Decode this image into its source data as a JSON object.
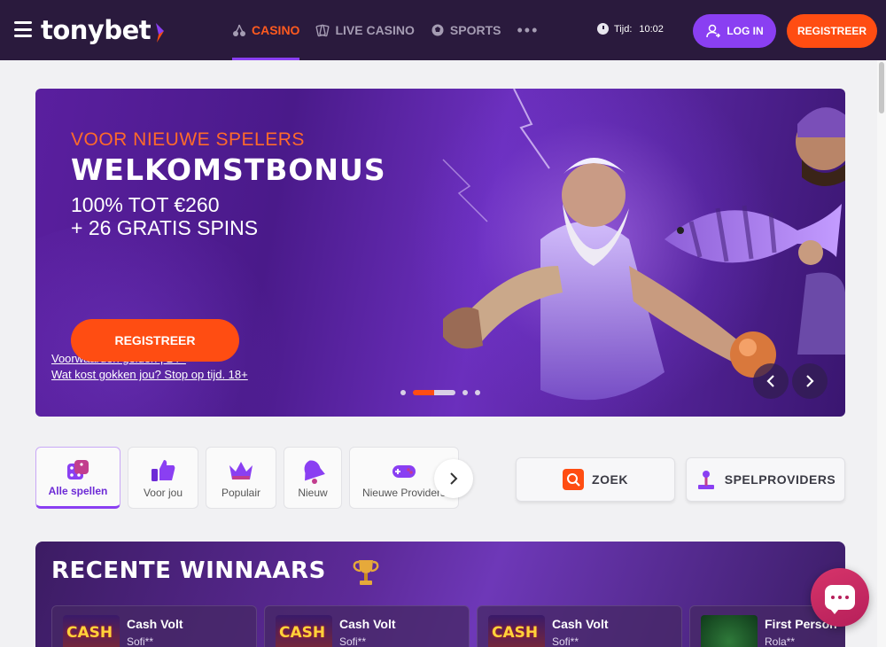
{
  "header": {
    "logo_text": "tonybet",
    "nav": [
      {
        "label": "CASINO",
        "icon": "cherries-icon",
        "active": true
      },
      {
        "label": "LIVE CASINO",
        "icon": "cards-icon",
        "active": false
      },
      {
        "label": "SPORTS",
        "icon": "ball-icon",
        "active": false
      }
    ],
    "more_label": "•••",
    "time_label": "Tijd:",
    "time_value": "10:02",
    "login_label": "LOG IN",
    "register_label": "REGISTREER"
  },
  "banner": {
    "subtitle": "VOOR NIEUWE SPELERS",
    "title": "WELKOMSTBONUS",
    "line1": "100% TOT €260",
    "line2": "+ 26 GRATIS SPINS",
    "button_label": "REGISTREER",
    "terms_link": "Voorwaarden gelden | 24+",
    "gambling_link": "Wat kost gokken jou? Stop op tijd. 18+",
    "slides_count": 5,
    "active_slide": 2
  },
  "categories": [
    {
      "label": "Alle spellen",
      "icon": "dice-icon",
      "active": true
    },
    {
      "label": "Voor jou",
      "icon": "thumbs-up-icon",
      "active": false
    },
    {
      "label": "Populair",
      "icon": "crown-icon",
      "active": false
    },
    {
      "label": "Nieuw",
      "icon": "bell-icon",
      "active": false
    },
    {
      "label": "Nieuwe Providers",
      "icon": "gamepad-icon",
      "active": false
    }
  ],
  "actions": {
    "search_label": "ZOEK",
    "providers_label": "SPELPROVIDERS"
  },
  "winners": {
    "title": "RECENTE WINNAARS",
    "items": [
      {
        "game": "Cash Volt",
        "user": "Sofi**",
        "thumb_text": "CASH"
      },
      {
        "game": "Cash Volt",
        "user": "Sofi**",
        "thumb_text": "CASH"
      },
      {
        "game": "Cash Volt",
        "user": "Sofi**",
        "thumb_text": "CASH"
      },
      {
        "game": "First Person",
        "user": "Rola**",
        "thumb_text": ""
      }
    ]
  },
  "colors": {
    "header_bg": "#2a1a3d",
    "accent_orange": "#ff4d12",
    "accent_purple": "#8a3ff2"
  }
}
